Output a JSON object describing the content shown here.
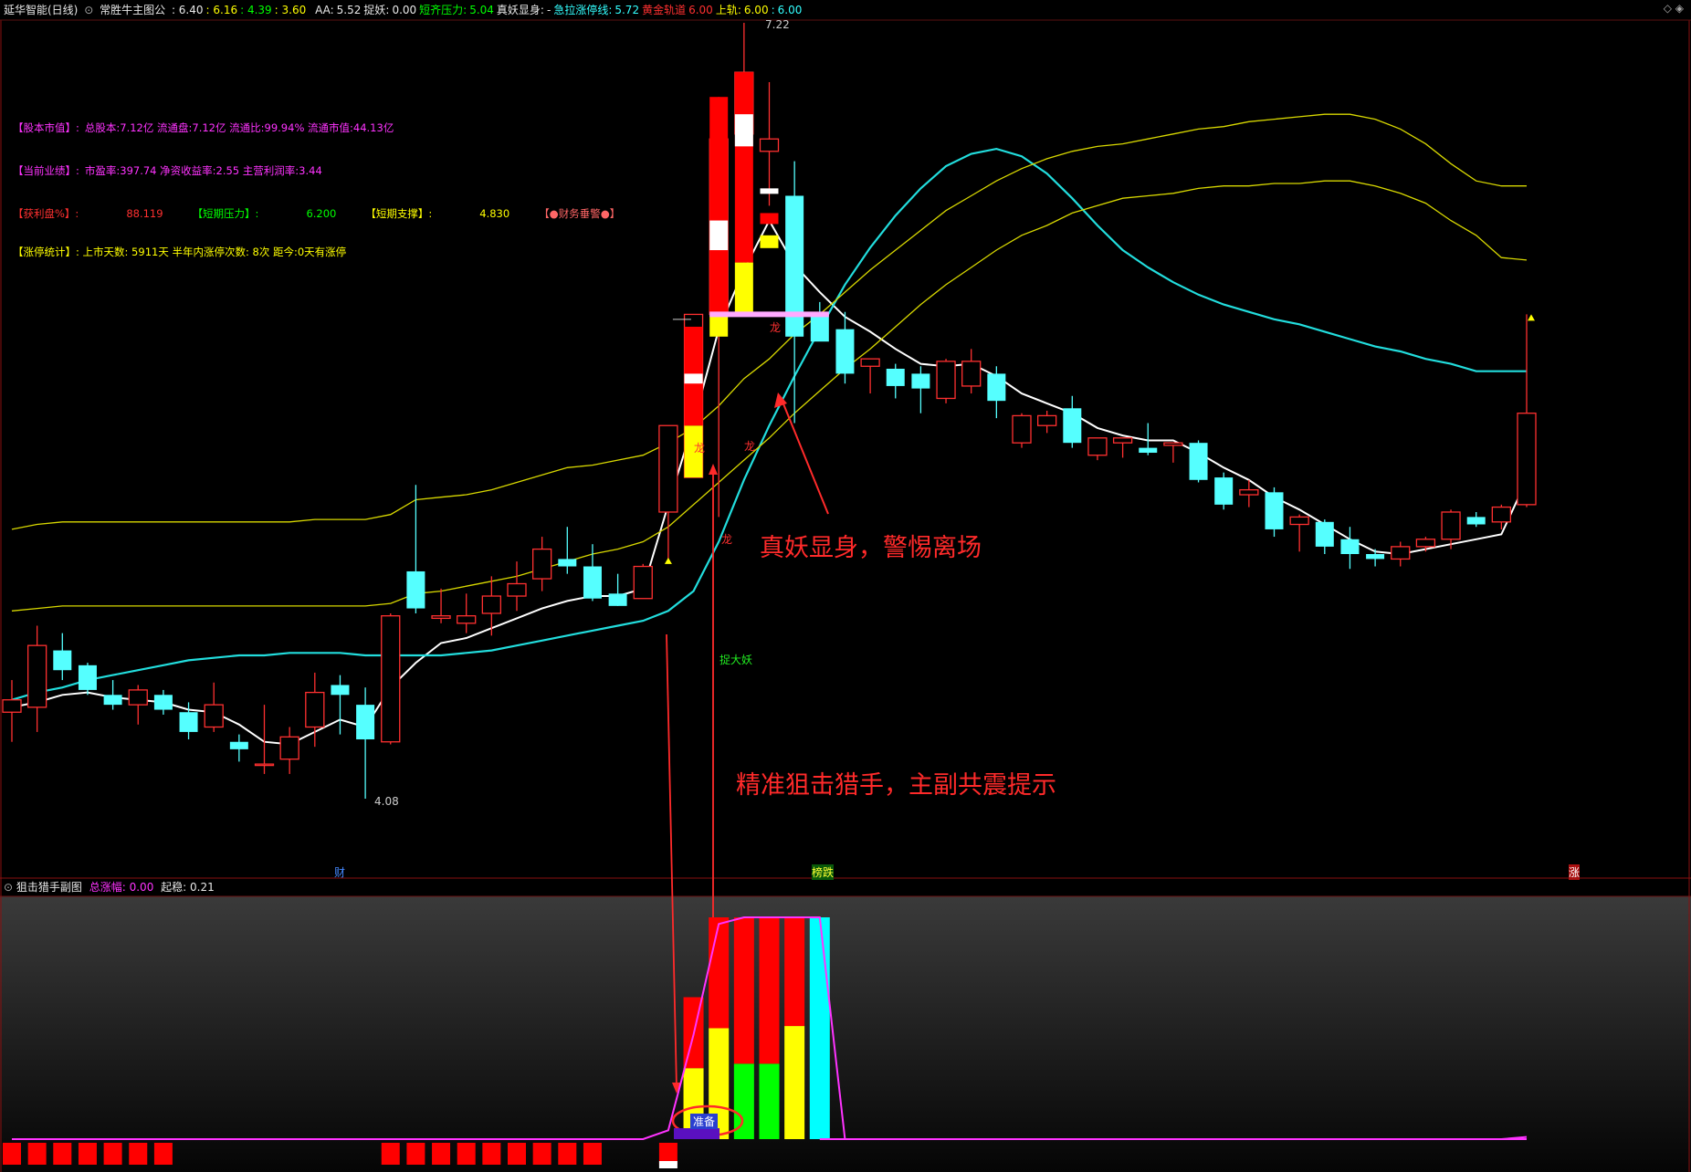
{
  "header": {
    "title": "延华智能(日线)",
    "indicator": "常胜牛主图公",
    "ohlc": [
      {
        "v": ": 6.40",
        "c": "#e8e8e8"
      },
      {
        "v": ": 6.16",
        "c": "#ffff00"
      },
      {
        "v": ": 4.39",
        "c": "#00ff00"
      },
      {
        "v": ": 3.60",
        "c": "#ffff00"
      }
    ],
    "fields": [
      {
        "k": "AA:",
        "v": "5.52",
        "kc": "#e8e8e8",
        "vc": "#e8e8e8"
      },
      {
        "k": "捉妖:",
        "v": "0.00",
        "kc": "#e8e8e8",
        "vc": "#e8e8e8"
      },
      {
        "k": "短齐压力:",
        "v": "5.04",
        "kc": "#00ff00",
        "vc": "#00ff00"
      },
      {
        "k": "真妖显身:",
        "v": "-",
        "kc": "#e8e8e8",
        "vc": "#e8e8e8"
      },
      {
        "k": "急拉涨停线:",
        "v": "5.72",
        "kc": "#33ffff",
        "vc": "#33ffff"
      },
      {
        "k": "黄金轨道",
        "v": "6.00",
        "kc": "#ff3030",
        "vc": "#ff3030"
      },
      {
        "k": "上轨:",
        "v": "6.00",
        "kc": "#ffff00",
        "vc": "#ffff00"
      },
      {
        "k": ":",
        "v": "6.00",
        "kc": "#33ffff",
        "vc": "#33ffff"
      }
    ],
    "corner": "◇ ◈"
  },
  "info": [
    [
      {
        "t": "【股本市值】:",
        "c": "#ff33ff"
      },
      {
        "t": "总股本:7.12亿 流通盘:7.12亿 流通比:99.94% 流通市值:44.13亿",
        "c": "#ff33ff"
      }
    ],
    [
      {
        "t": "【当前业绩】:",
        "c": "#ff33ff"
      },
      {
        "t": "市盈率:397.74 净资收益率:2.55 主营利润率:3.44",
        "c": "#ff33ff"
      }
    ],
    [
      {
        "t": "【获利盘%】:",
        "c": "#ff3030"
      },
      {
        "t": "88.119",
        "c": "#ff3030"
      },
      {
        "t": "【短期压力】:",
        "c": "#00ff00"
      },
      {
        "t": "6.200",
        "c": "#00ff00"
      },
      {
        "t": "【短期支撑】:",
        "c": "#ffff00"
      },
      {
        "t": "4.830",
        "c": "#ffff00"
      },
      {
        "t": "【●财务垂警●】",
        "c": "#ff6666"
      }
    ],
    [
      {
        "t": "【涨停统计】: 上市天数: 5911天 半年内涨停次数: 8次  距今:0天有涨停",
        "c": "#ffff00"
      }
    ]
  ],
  "annotations": {
    "main": "真妖显身，警惕离场",
    "sub": "精准狙击猎手，主副共震提示"
  },
  "labels": {
    "high_price": "7.22",
    "low_price": "4.08",
    "catch": "捉大妖",
    "dragon": "龙",
    "ready": "准备",
    "bottom_cai": "财",
    "bottom_jing": "榜跌",
    "bottom_zhang": "涨"
  },
  "subchart": {
    "title": "狙击猎手副图",
    "f1k": "总涨幅:",
    "f1v": "0.00",
    "f2k": "起稳:",
    "f2v": "0.21"
  },
  "colors": {
    "up": "#ff3030",
    "down": "#55ffff",
    "ma_white": "#ffffff",
    "ma_cyan": "#22dddd",
    "band_yellow": "#d8d800",
    "pink": "#ffaaff",
    "magenta": "#ff33ff"
  },
  "chart_data": {
    "type": "candlestick",
    "title": "延华智能(日线)",
    "price_range": [
      3.6,
      7.22
    ],
    "candles": [
      {
        "o": 4.43,
        "h": 4.56,
        "l": 4.31,
        "c": 4.48
      },
      {
        "o": 4.45,
        "h": 4.78,
        "l": 4.35,
        "c": 4.7
      },
      {
        "o": 4.68,
        "h": 4.75,
        "l": 4.56,
        "c": 4.6
      },
      {
        "o": 4.62,
        "h": 4.63,
        "l": 4.5,
        "c": 4.52
      },
      {
        "o": 4.5,
        "h": 4.56,
        "l": 4.44,
        "c": 4.46
      },
      {
        "o": 4.46,
        "h": 4.54,
        "l": 4.38,
        "c": 4.52
      },
      {
        "o": 4.5,
        "h": 4.52,
        "l": 4.42,
        "c": 4.44
      },
      {
        "o": 4.43,
        "h": 4.47,
        "l": 4.32,
        "c": 4.35
      },
      {
        "o": 4.37,
        "h": 4.55,
        "l": 4.35,
        "c": 4.46
      },
      {
        "o": 4.31,
        "h": 4.34,
        "l": 4.23,
        "c": 4.28
      },
      {
        "o": 4.22,
        "h": 4.46,
        "l": 4.18,
        "c": 4.22
      },
      {
        "o": 4.24,
        "h": 4.37,
        "l": 4.18,
        "c": 4.33
      },
      {
        "o": 4.37,
        "h": 4.59,
        "l": 4.29,
        "c": 4.51
      },
      {
        "o": 4.54,
        "h": 4.58,
        "l": 4.34,
        "c": 4.5
      },
      {
        "o": 4.46,
        "h": 4.53,
        "l": 4.08,
        "c": 4.32
      },
      {
        "o": 4.31,
        "h": 4.83,
        "l": 4.3,
        "c": 4.82
      },
      {
        "o": 5.0,
        "h": 5.35,
        "l": 4.83,
        "c": 4.85
      },
      {
        "o": 4.81,
        "h": 4.93,
        "l": 4.79,
        "c": 4.82
      },
      {
        "o": 4.79,
        "h": 4.91,
        "l": 4.75,
        "c": 4.82
      },
      {
        "o": 4.83,
        "h": 4.98,
        "l": 4.74,
        "c": 4.9
      },
      {
        "o": 4.9,
        "h": 5.04,
        "l": 4.84,
        "c": 4.95
      },
      {
        "o": 4.97,
        "h": 5.14,
        "l": 4.92,
        "c": 5.09
      },
      {
        "o": 5.05,
        "h": 5.18,
        "l": 4.99,
        "c": 5.02
      },
      {
        "o": 5.02,
        "h": 5.11,
        "l": 4.88,
        "c": 4.89
      },
      {
        "o": 4.91,
        "h": 4.99,
        "l": 4.86,
        "c": 4.86
      },
      {
        "o": 4.89,
        "h": 5.03,
        "l": 4.89,
        "c": 5.02
      },
      {
        "o": 5.24,
        "h": 5.49,
        "l": 5.04,
        "c": 5.59
      },
      {
        "o": 5.38,
        "h": 5.99,
        "l": 5.38,
        "c": 6.04
      },
      {
        "o": 6.04,
        "h": 6.92,
        "l": 5.22,
        "c": 6.75
      },
      {
        "o": 6.77,
        "h": 7.22,
        "l": 6.2,
        "c": 7.02
      },
      {
        "o": 6.7,
        "h": 6.98,
        "l": 6.48,
        "c": 6.75
      },
      {
        "o": 6.52,
        "h": 6.66,
        "l": 5.6,
        "c": 5.95
      },
      {
        "o": 6.05,
        "h": 6.09,
        "l": 5.97,
        "c": 5.93
      },
      {
        "o": 5.98,
        "h": 6.05,
        "l": 5.76,
        "c": 5.8
      },
      {
        "o": 5.83,
        "h": 5.86,
        "l": 5.72,
        "c": 5.86
      },
      {
        "o": 5.82,
        "h": 5.84,
        "l": 5.7,
        "c": 5.75
      },
      {
        "o": 5.8,
        "h": 5.83,
        "l": 5.64,
        "c": 5.74
      },
      {
        "o": 5.7,
        "h": 5.86,
        "l": 5.68,
        "c": 5.85
      },
      {
        "o": 5.75,
        "h": 5.9,
        "l": 5.72,
        "c": 5.85
      },
      {
        "o": 5.8,
        "h": 5.83,
        "l": 5.62,
        "c": 5.69
      },
      {
        "o": 5.52,
        "h": 5.64,
        "l": 5.5,
        "c": 5.63
      },
      {
        "o": 5.59,
        "h": 5.65,
        "l": 5.56,
        "c": 5.63
      },
      {
        "o": 5.66,
        "h": 5.71,
        "l": 5.5,
        "c": 5.52
      },
      {
        "o": 5.47,
        "h": 5.54,
        "l": 5.45,
        "c": 5.54
      },
      {
        "o": 5.52,
        "h": 5.54,
        "l": 5.46,
        "c": 5.54
      },
      {
        "o": 5.5,
        "h": 5.6,
        "l": 5.47,
        "c": 5.48
      },
      {
        "o": 5.51,
        "h": 5.52,
        "l": 5.44,
        "c": 5.52
      },
      {
        "o": 5.52,
        "h": 5.53,
        "l": 5.36,
        "c": 5.37
      },
      {
        "o": 5.38,
        "h": 5.4,
        "l": 5.25,
        "c": 5.27
      },
      {
        "o": 5.31,
        "h": 5.37,
        "l": 5.26,
        "c": 5.33
      },
      {
        "o": 5.32,
        "h": 5.34,
        "l": 5.14,
        "c": 5.17
      },
      {
        "o": 5.19,
        "h": 5.23,
        "l": 5.08,
        "c": 5.22
      },
      {
        "o": 5.2,
        "h": 5.21,
        "l": 5.07,
        "c": 5.1
      },
      {
        "o": 5.13,
        "h": 5.18,
        "l": 5.01,
        "c": 5.07
      },
      {
        "o": 5.07,
        "h": 5.09,
        "l": 5.02,
        "c": 5.05
      },
      {
        "o": 5.05,
        "h": 5.12,
        "l": 5.02,
        "c": 5.1
      },
      {
        "o": 5.1,
        "h": 5.14,
        "l": 5.08,
        "c": 5.13
      },
      {
        "o": 5.13,
        "h": 5.25,
        "l": 5.09,
        "c": 5.24
      },
      {
        "o": 5.22,
        "h": 5.24,
        "l": 5.18,
        "c": 5.19
      },
      {
        "o": 5.2,
        "h": 5.27,
        "l": 5.17,
        "c": 5.26
      },
      {
        "o": 5.27,
        "h": 6.04,
        "l": 5.26,
        "c": 5.64
      }
    ],
    "series": [
      {
        "name": "AA",
        "color": "#ffffff",
        "values": [
          4.45,
          4.47,
          4.5,
          4.51,
          4.49,
          4.48,
          4.47,
          4.44,
          4.43,
          4.38,
          4.31,
          4.3,
          4.35,
          4.4,
          4.37,
          4.53,
          4.63,
          4.71,
          4.73,
          4.77,
          4.81,
          4.85,
          4.88,
          4.9,
          4.9,
          4.93,
          5.27,
          5.6,
          5.98,
          6.22,
          6.42,
          6.24,
          6.13,
          6.03,
          5.97,
          5.9,
          5.84,
          5.83,
          5.84,
          5.79,
          5.72,
          5.68,
          5.64,
          5.58,
          5.55,
          5.53,
          5.53,
          5.48,
          5.42,
          5.37,
          5.3,
          5.25,
          5.19,
          5.13,
          5.08,
          5.07,
          5.09,
          5.11,
          5.13,
          5.15,
          5.37
        ]
      },
      {
        "name": "急拉涨停线",
        "color": "#22dddd",
        "values": [
          4.48,
          4.51,
          4.53,
          4.56,
          4.58,
          4.6,
          4.62,
          4.64,
          4.65,
          4.66,
          4.66,
          4.67,
          4.67,
          4.67,
          4.66,
          4.66,
          4.66,
          4.66,
          4.67,
          4.68,
          4.7,
          4.72,
          4.74,
          4.76,
          4.78,
          4.8,
          4.84,
          4.92,
          5.12,
          5.37,
          5.59,
          5.79,
          5.98,
          6.16,
          6.31,
          6.44,
          6.55,
          6.64,
          6.69,
          6.71,
          6.68,
          6.61,
          6.51,
          6.4,
          6.3,
          6.23,
          6.17,
          6.12,
          6.08,
          6.05,
          6.02,
          6.0,
          5.97,
          5.94,
          5.91,
          5.89,
          5.86,
          5.84,
          5.81,
          5.81,
          5.81
        ]
      },
      {
        "name": "上轨",
        "color": "#d8d800",
        "values": [
          5.17,
          5.19,
          5.2,
          5.2,
          5.2,
          5.2,
          5.2,
          5.2,
          5.2,
          5.2,
          5.2,
          5.2,
          5.21,
          5.21,
          5.21,
          5.23,
          5.29,
          5.3,
          5.31,
          5.33,
          5.36,
          5.39,
          5.42,
          5.43,
          5.45,
          5.47,
          5.52,
          5.58,
          5.67,
          5.78,
          5.86,
          5.96,
          6.04,
          6.13,
          6.22,
          6.3,
          6.38,
          6.46,
          6.52,
          6.58,
          6.63,
          6.67,
          6.7,
          6.72,
          6.73,
          6.75,
          6.77,
          6.79,
          6.8,
          6.82,
          6.83,
          6.84,
          6.85,
          6.85,
          6.83,
          6.79,
          6.73,
          6.65,
          6.58,
          6.56,
          6.56
        ]
      },
      {
        "name": "下轨",
        "color": "#d8d800",
        "values": [
          4.84,
          4.85,
          4.86,
          4.86,
          4.86,
          4.86,
          4.86,
          4.86,
          4.86,
          4.86,
          4.86,
          4.86,
          4.86,
          4.86,
          4.86,
          4.87,
          4.91,
          4.92,
          4.94,
          4.96,
          4.98,
          5.01,
          5.04,
          5.07,
          5.09,
          5.12,
          5.18,
          5.27,
          5.36,
          5.45,
          5.54,
          5.64,
          5.73,
          5.82,
          5.9,
          5.99,
          6.08,
          6.16,
          6.23,
          6.3,
          6.36,
          6.4,
          6.45,
          6.48,
          6.51,
          6.52,
          6.53,
          6.55,
          6.56,
          6.56,
          6.57,
          6.57,
          6.58,
          6.58,
          6.56,
          6.53,
          6.49,
          6.42,
          6.36,
          6.27,
          6.26
        ]
      }
    ],
    "sub_bars": [
      {
        "i": 27,
        "parts": [
          {
            "h": 0.32,
            "c": "#ffff00"
          },
          {
            "h": 0.32,
            "c": "#ff0000"
          }
        ]
      },
      {
        "i": 28,
        "parts": [
          {
            "h": 0.5,
            "c": "#ffff00"
          },
          {
            "h": 0.5,
            "c": "#ff0000"
          }
        ]
      },
      {
        "i": 29,
        "parts": [
          {
            "h": 0.34,
            "c": "#00ff00"
          },
          {
            "h": 0.66,
            "c": "#ff0000"
          }
        ]
      },
      {
        "i": 30,
        "parts": [
          {
            "h": 0.34,
            "c": "#00ff00"
          },
          {
            "h": 0.66,
            "c": "#ff0000"
          }
        ]
      },
      {
        "i": 31,
        "parts": [
          {
            "h": 0.51,
            "c": "#ffff00"
          },
          {
            "h": 0.49,
            "c": "#ff0000"
          }
        ]
      },
      {
        "i": 32,
        "parts": [
          {
            "h": 1.0,
            "c": "#00ffff"
          }
        ]
      }
    ],
    "sub_line": [
      0,
      0,
      0,
      0,
      0,
      0,
      0,
      0,
      0,
      0,
      0,
      0,
      0,
      0,
      0,
      0,
      0,
      0,
      0,
      0,
      0,
      0,
      0,
      0,
      0,
      0,
      0.04,
      0.47,
      0.97,
      1.0,
      1.0,
      1.0,
      1.0,
      0,
      0,
      0,
      0,
      0,
      0,
      0,
      0,
      0,
      0,
      0,
      0,
      0,
      0,
      0,
      0,
      0,
      0,
      0,
      0,
      0,
      0,
      0,
      0,
      0,
      0,
      0,
      0.01
    ],
    "sub_squares": [
      0,
      1,
      2,
      3,
      4,
      5,
      6,
      15,
      16,
      17,
      18,
      19,
      20,
      21,
      22,
      23,
      26
    ]
  }
}
